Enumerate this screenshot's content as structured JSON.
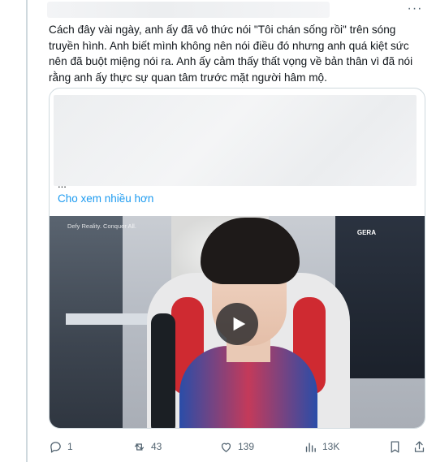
{
  "tweet": {
    "text": "Cách đây vài ngày, anh ấy đã vô thức nói \"Tôi chán sống rồi\" trên sóng truyền hình. Anh biết mình không nên nói điều đó nhưng anh quá kiệt sức nên đã buột miệng nói ra. Anh ấy cảm thấy thất vọng về bản thân vì đã nói rằng anh ấy thực sự quan tâm trước mặt người hâm mộ.",
    "more_icon": "more-horizontal-icon"
  },
  "quote": {
    "ellipsis": "...",
    "show_more": "Cho xem nhiều hơn"
  },
  "video": {
    "overlay_caption": "Defy Reality. Conquer All.",
    "jersey_text": "GERA",
    "play_icon": "play-icon"
  },
  "actions": {
    "reply": {
      "icon": "reply-icon",
      "count": "1"
    },
    "retweet": {
      "icon": "retweet-icon",
      "count": "43"
    },
    "like": {
      "icon": "heart-icon",
      "count": "139"
    },
    "views": {
      "icon": "views-icon",
      "count": "13K"
    },
    "bookmark": {
      "icon": "bookmark-icon"
    },
    "share": {
      "icon": "share-icon"
    }
  },
  "colors": {
    "text": "#0f1419",
    "muted": "#536471",
    "link": "#1d9bf0",
    "border": "#cfd9de"
  }
}
